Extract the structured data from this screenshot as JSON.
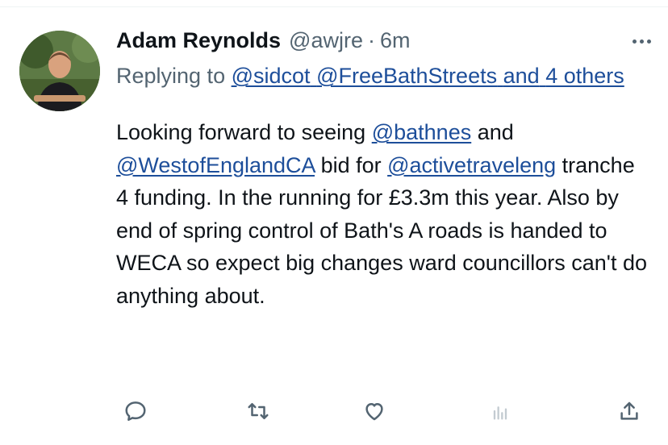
{
  "tweet": {
    "author": {
      "display_name": "Adam Reynolds",
      "handle": "@awjre",
      "separator": "·",
      "time": "6m"
    },
    "replying": {
      "prefix": "Replying to",
      "mention1": "@sidcot",
      "mention2": "@FreeBathStreets",
      "and_text": "and",
      "others": "4 others"
    },
    "body": {
      "t1": "Looking forward to seeing",
      "m_bathnes": "@bathnes",
      "t2": "and",
      "m_weca": "@WestofEnglandCA",
      "t3": "bid for",
      "m_active": "@activetraveleng",
      "t4": "tranche 4 funding. In the running for £3.3m this year. Also by end of spring control of Bath's A roads is handed to WECA so expect big changes ward councillors can't do anything about."
    },
    "actions": {
      "reply": "reply-icon",
      "retweet": "retweet-icon",
      "like": "heart-icon",
      "views": "analytics-icon",
      "share": "share-icon"
    }
  },
  "colors": {
    "text": "#0f1419",
    "secondary": "#536471",
    "link": "#1d4e9a"
  }
}
